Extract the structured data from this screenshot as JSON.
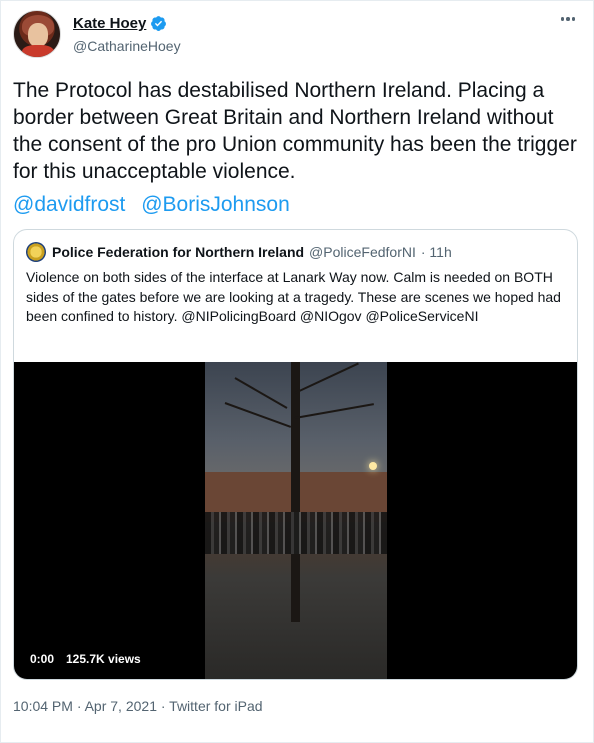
{
  "author": {
    "display_name": "Kate Hoey",
    "handle": "@CatharineHoey"
  },
  "tweet": {
    "text": "The Protocol has destabilised Northern Ireland. Placing a border between Great Britain and Northern Ireland without the consent of the pro Union community has been the trigger for this unacceptable violence.",
    "mentions": [
      "@davidfrost",
      "@BorisJohnson"
    ]
  },
  "quoted": {
    "display_name": "Police Federation for Northern Ireland",
    "handle": "@PoliceFedforNI",
    "age": "· 11h",
    "text": "Violence on both sides of the interface at Lanark Way now. Calm is needed on BOTH sides of the gates before we are looking at a tragedy. These are scenes we hoped had been confined to history. @NIPolicingBoard @NIOgov @PoliceServiceNI",
    "video": {
      "time": "0:00",
      "views": "125.7K views"
    }
  },
  "footer": {
    "timestamp": "10:04 PM · Apr 7, 2021 · ",
    "source": "Twitter for iPad"
  },
  "colors": {
    "accent": "#1d9bf0",
    "secondary_text": "#536471",
    "border": "#cfd9de"
  }
}
